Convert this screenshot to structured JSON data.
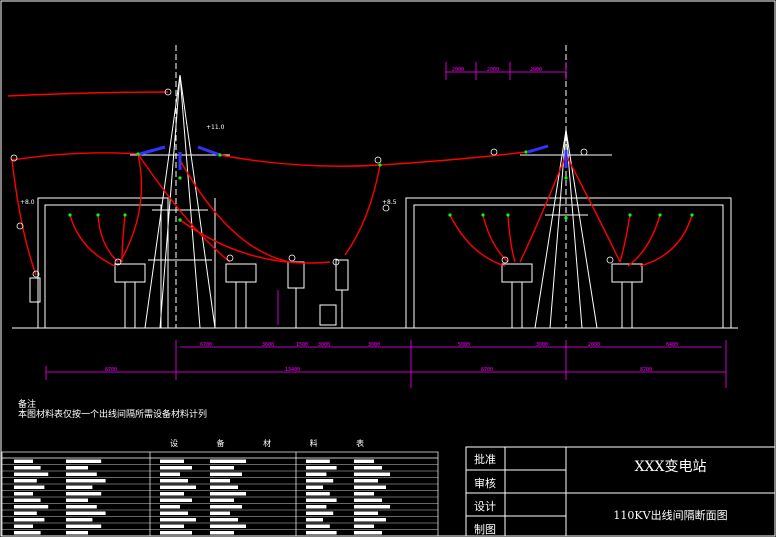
{
  "notes": {
    "heading": "备注",
    "line1": "本图材料表仅按一个出线间隔所需设备材料计列"
  },
  "material_table": {
    "title": "设 备 材 料 表"
  },
  "title_block": {
    "approve": "批准",
    "review": "审核",
    "design": "设计",
    "draw": "制图",
    "project": "XXX变电站",
    "drawing": "110KV出线间隔断面图"
  },
  "elevations": {
    "e1": "+11.0",
    "e2": "+8.0",
    "e3": "+8.5"
  },
  "dims_top": [
    "2000",
    "2000",
    "2000"
  ],
  "dims_row1": [
    "6700",
    "3600",
    "1500",
    "3000",
    "3000",
    "5000",
    "3000",
    "2000",
    "6400"
  ],
  "dims_row2": [
    "8700",
    "13400",
    "8700",
    "8700"
  ],
  "colors": {
    "structure": "#ffffff",
    "conductor": "#ff0000",
    "dimension": "#ff00ff",
    "insulator": "#3333ff",
    "node": "#00ff00"
  }
}
